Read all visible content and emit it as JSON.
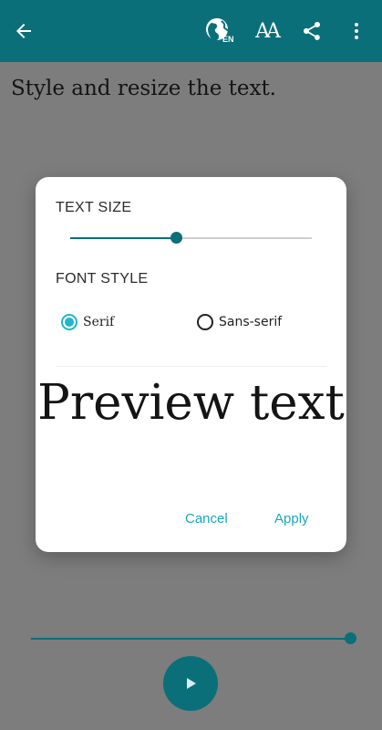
{
  "appbar": {
    "icons": [
      "back-arrow-icon",
      "language-globe-icon",
      "font-size-icon",
      "share-icon",
      "more-vert-icon"
    ],
    "language_code": "EN",
    "font_icon_text": "AA"
  },
  "content": {
    "text": "Style and resize the text."
  },
  "dialog": {
    "text_size_label": "TEXT SIZE",
    "text_size_value": 0.44,
    "font_style_label": "FONT STYLE",
    "options": [
      {
        "label": "Serif",
        "selected": true
      },
      {
        "label": "Sans-serif",
        "selected": false
      }
    ],
    "preview_text": "Preview text",
    "cancel_label": "Cancel",
    "apply_label": "Apply"
  },
  "player": {
    "progress": 1.0,
    "play_icon": "play-icon"
  },
  "colors": {
    "primary": "#0a6f79",
    "accent": "#21b6cc",
    "button_text": "#1aa6bf"
  }
}
